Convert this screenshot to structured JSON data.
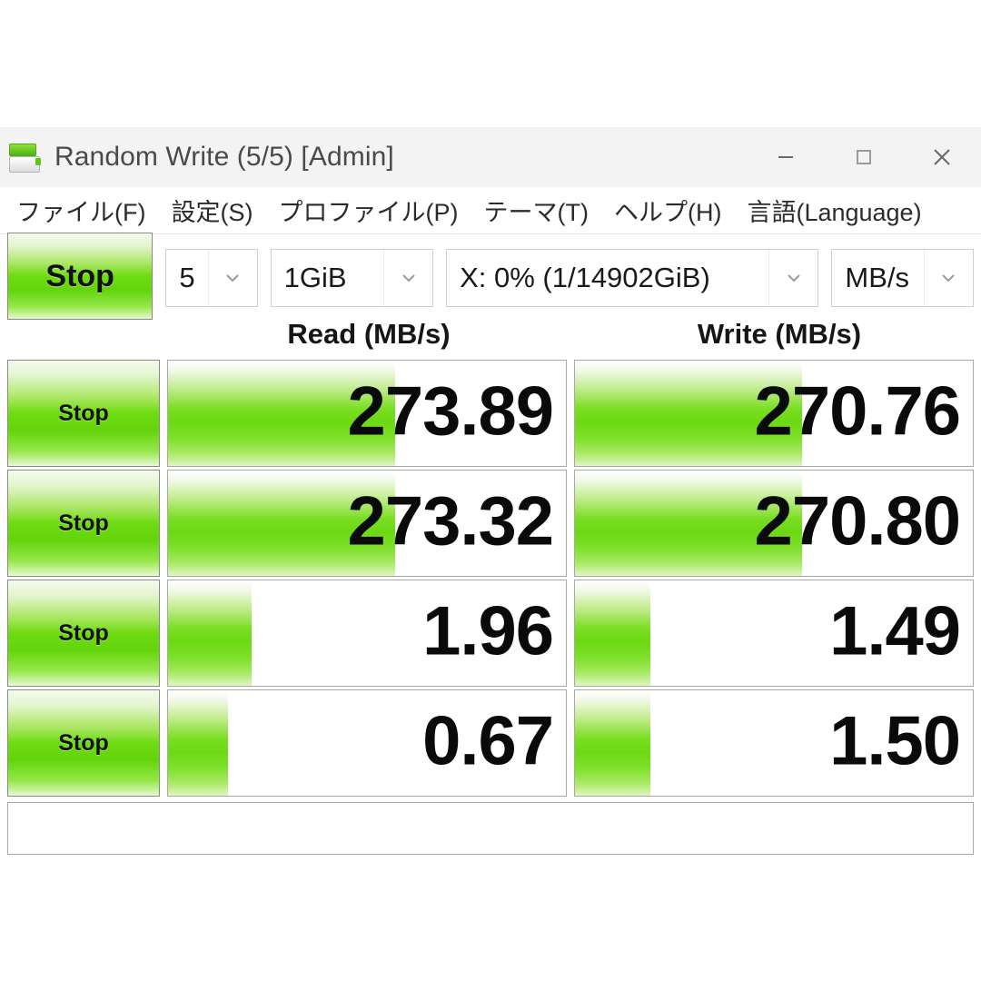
{
  "window": {
    "title": "Random Write (5/5) [Admin]",
    "icon": "disk-drive-icon",
    "controls": {
      "minimize": "minimize-icon",
      "maximize": "maximize-icon",
      "close": "close-icon"
    }
  },
  "menubar": {
    "items": [
      {
        "label": "ファイル(F)",
        "name": "menu-file"
      },
      {
        "label": "設定(S)",
        "name": "menu-settings"
      },
      {
        "label": "プロファイル(P)",
        "name": "menu-profile"
      },
      {
        "label": "テーマ(T)",
        "name": "menu-theme"
      },
      {
        "label": "ヘルプ(H)",
        "name": "menu-help"
      },
      {
        "label": "言語(Language)",
        "name": "menu-language"
      }
    ]
  },
  "toolbar": {
    "all_button_label": "Stop",
    "loops_value": "5",
    "size_value": "1GiB",
    "drive_value": "X: 0% (1/14902GiB)",
    "unit_value": "MB/s"
  },
  "headers": {
    "read": "Read (MB/s)",
    "write": "Write (MB/s)"
  },
  "statusbar": {
    "text": ""
  },
  "colors": {
    "accent_green": "#6cd913",
    "titlebar_bg": "#f3f3f3",
    "text": "#0a0a0a"
  },
  "chart_data": {
    "type": "bar",
    "title": "CrystalDiskMark benchmark results",
    "unit": "MB/s",
    "columns": [
      "Read (MB/s)",
      "Write (MB/s)"
    ],
    "rows": [
      {
        "button_label": "Stop",
        "read_value": "273.89",
        "write_value": "270.76",
        "read_fill_pct": 57,
        "write_fill_pct": 57
      },
      {
        "button_label": "Stop",
        "read_value": "273.32",
        "write_value": "270.80",
        "read_fill_pct": 57,
        "write_fill_pct": 57
      },
      {
        "button_label": "Stop",
        "read_value": "1.96",
        "write_value": "1.49",
        "read_fill_pct": 21,
        "write_fill_pct": 19
      },
      {
        "button_label": "Stop",
        "read_value": "0.67",
        "write_value": "1.50",
        "read_fill_pct": 15,
        "write_fill_pct": 19
      }
    ]
  }
}
